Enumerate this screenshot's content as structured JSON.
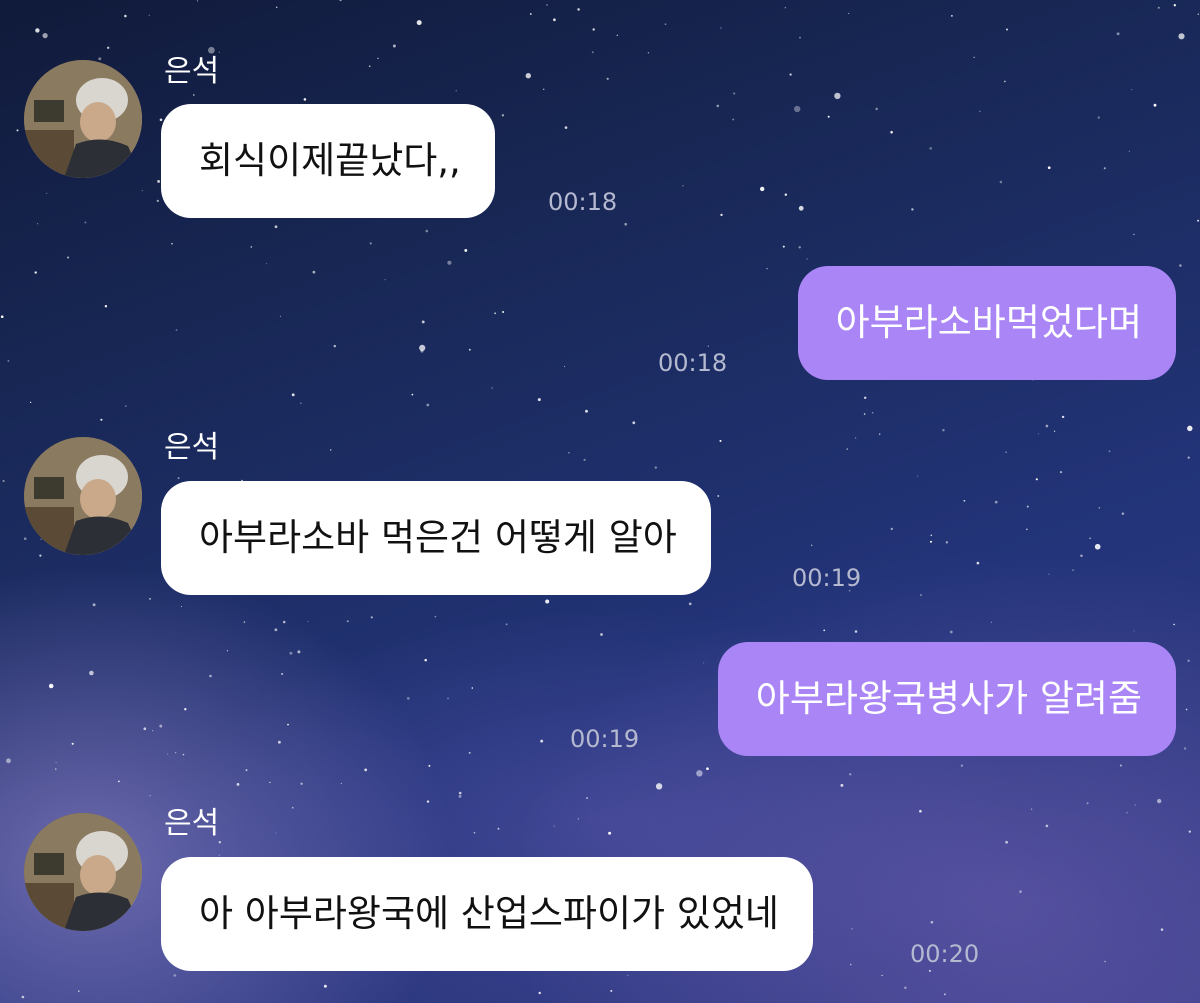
{
  "messages": [
    {
      "sender": "은석",
      "direction": "in",
      "text": "회식이제끝났다,,",
      "time": "00:18"
    },
    {
      "direction": "out",
      "text": "아부라소바먹었다며",
      "time": "00:18"
    },
    {
      "sender": "은석",
      "direction": "in",
      "text": "아부라소바 먹은건 어떻게 알아",
      "time": "00:19"
    },
    {
      "direction": "out",
      "text": "아부라왕국병사가 알려줌",
      "time": "00:19"
    },
    {
      "sender": "은석",
      "direction": "in",
      "text": "아 아부라왕국에 산업스파이가 있었네",
      "time": "00:20"
    }
  ],
  "colors": {
    "incoming_bubble": "#ffffff",
    "outgoing_bubble": "#a985f5",
    "timestamp": "#b5b9cf",
    "background": "#1a2a5c"
  }
}
